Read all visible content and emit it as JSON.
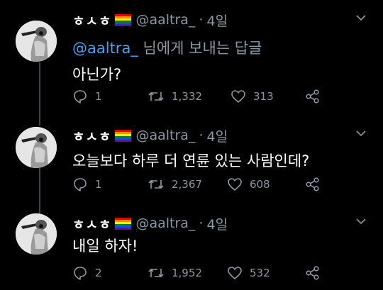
{
  "tweets": [
    {
      "display_name": "ㅎㅅㅎ",
      "handle": "@aaltra_",
      "separator": "·",
      "time": "4일",
      "reply_to_mention": "@aaltra_",
      "reply_to_suffix": "님에게 보내는 답글",
      "text": "아닌가?",
      "replies": "1",
      "retweets": "1,332",
      "likes": "313"
    },
    {
      "display_name": "ㅎㅅㅎ",
      "handle": "@aaltra_",
      "separator": "·",
      "time": "4일",
      "text": "오늘보다 하루 더 연륜 있는 사람인데?",
      "replies": "1",
      "retweets": "2,367",
      "likes": "608"
    },
    {
      "display_name": "ㅎㅅㅎ",
      "handle": "@aaltra_",
      "separator": "·",
      "time": "4일",
      "text": "내일 하자!",
      "replies": "2",
      "retweets": "1,952",
      "likes": "532"
    }
  ],
  "colors": {
    "background": "#000000",
    "secondary_text": "#8b98a5",
    "mention": "#4aa0ec",
    "thread_line": "#3d4348"
  },
  "icons": [
    "reply-icon",
    "retweet-icon",
    "like-icon",
    "share-icon",
    "caret-down-icon",
    "rainbow-flag-icon"
  ]
}
